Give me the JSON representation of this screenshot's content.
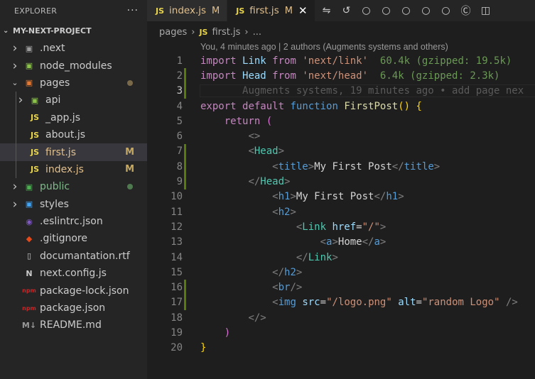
{
  "sidebar": {
    "title": "EXPLORER",
    "more": "···",
    "project": "MY-NEXT-PROJECT",
    "items": [
      {
        "label": ".next",
        "type": "folder",
        "icon": "next-folder-icon",
        "depth": 1,
        "badge": ""
      },
      {
        "label": "node_modules",
        "type": "folder",
        "icon": "node-modules-folder-icon",
        "depth": 1,
        "badge": ""
      },
      {
        "label": "pages",
        "type": "folder-open",
        "icon": "pages-folder-icon",
        "depth": 1,
        "badge": "dot-brown"
      },
      {
        "label": "api",
        "type": "folder",
        "icon": "api-folder-icon",
        "depth": 2,
        "badge": ""
      },
      {
        "label": "_app.js",
        "type": "file",
        "icon": "js-file-icon",
        "depth": 2,
        "badge": ""
      },
      {
        "label": "about.js",
        "type": "file",
        "icon": "js-file-icon",
        "depth": 2,
        "badge": ""
      },
      {
        "label": "first.js",
        "type": "file",
        "icon": "js-file-icon",
        "depth": 2,
        "badge": "M",
        "active": true
      },
      {
        "label": "index.js",
        "type": "file",
        "icon": "js-file-icon",
        "depth": 2,
        "badge": "M"
      },
      {
        "label": "public",
        "type": "folder",
        "icon": "public-folder-icon",
        "depth": 1,
        "badge": "dot-green"
      },
      {
        "label": "styles",
        "type": "folder",
        "icon": "styles-folder-icon",
        "depth": 1,
        "badge": ""
      },
      {
        "label": ".eslintrc.json",
        "type": "file",
        "icon": "eslint-icon",
        "depth": 1,
        "badge": ""
      },
      {
        "label": ".gitignore",
        "type": "file",
        "icon": "git-icon",
        "depth": 1,
        "badge": ""
      },
      {
        "label": "documantation.rtf",
        "type": "file",
        "icon": "document-icon",
        "depth": 1,
        "badge": ""
      },
      {
        "label": "next.config.js",
        "type": "file",
        "icon": "next-config-icon",
        "depth": 1,
        "badge": ""
      },
      {
        "label": "package-lock.json",
        "type": "file",
        "icon": "npm-icon",
        "depth": 1,
        "badge": ""
      },
      {
        "label": "package.json",
        "type": "file",
        "icon": "npm-icon",
        "depth": 1,
        "badge": ""
      },
      {
        "label": "README.md",
        "type": "file",
        "icon": "markdown-icon",
        "depth": 1,
        "badge": ""
      }
    ]
  },
  "tabs": [
    {
      "js": "JS",
      "label": "index.js",
      "badge": "M",
      "active": false
    },
    {
      "js": "JS",
      "label": "first.js",
      "badge": "M",
      "active": true,
      "close": "✕"
    }
  ],
  "breadcrumb": {
    "folder": "pages",
    "sep": "›",
    "js": "JS",
    "file": "first.js",
    "tail": "..."
  },
  "editor": {
    "codelens": "You, 4 minutes ago | 2 authors (Augments systems and others)",
    "import_cost_1": "60.4k (gzipped: 19.5k)",
    "import_cost_2": "6.4k (gzipped: 2.3k)",
    "blame_line_3": "Augments systems, 19 minutes ago • add page nex",
    "line_numbers": [
      "1",
      "2",
      "3",
      "4",
      "5",
      "6",
      "7",
      "8",
      "9",
      "10",
      "11",
      "12",
      "13",
      "14",
      "15",
      "16",
      "17",
      "18",
      "19",
      "20"
    ],
    "strings": {
      "import": "import",
      "from": "from",
      "link": "Link",
      "head": "Head",
      "next_link": "'next/link'",
      "next_head": "'next/head'",
      "export": "export",
      "default": "default",
      "function": "function",
      "fname": "FirstPost",
      "return": "return",
      "title": "title",
      "title_text": "My First Post",
      "h1": "h1",
      "h1_text": "My First Post",
      "h2": "h2",
      "href": "href",
      "href_val": "\"/\"",
      "a": "a",
      "a_text": "Home",
      "br": "br",
      "img": "img",
      "src": "src",
      "src_val": "\"/logo.png\"",
      "alt": "alt",
      "alt_val": "\"random Logo\""
    }
  },
  "colors": {
    "git_added": "#587c0c",
    "modified": "#e2c08d",
    "accent_js": "#e8d44d"
  }
}
